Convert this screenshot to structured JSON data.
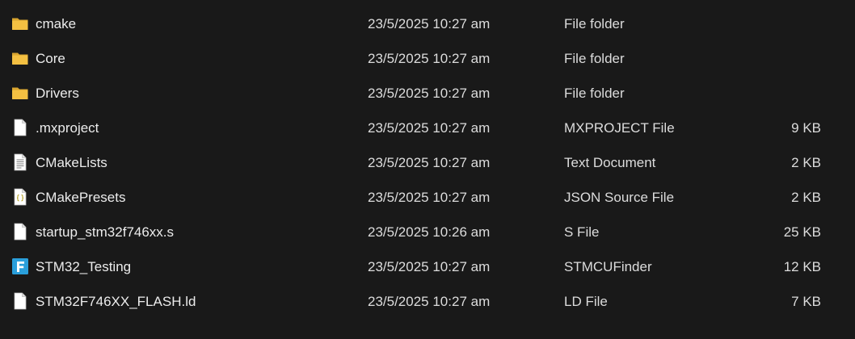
{
  "files": [
    {
      "name": "cmake",
      "date": "23/5/2025 10:27 am",
      "type": "File folder",
      "size": "",
      "icon": "folder-icon"
    },
    {
      "name": "Core",
      "date": "23/5/2025 10:27 am",
      "type": "File folder",
      "size": "",
      "icon": "folder-icon"
    },
    {
      "name": "Drivers",
      "date": "23/5/2025 10:27 am",
      "type": "File folder",
      "size": "",
      "icon": "folder-icon"
    },
    {
      "name": ".mxproject",
      "date": "23/5/2025 10:27 am",
      "type": "MXPROJECT File",
      "size": "9 KB",
      "icon": "blank-file-icon"
    },
    {
      "name": "CMakeLists",
      "date": "23/5/2025 10:27 am",
      "type": "Text Document",
      "size": "2 KB",
      "icon": "text-file-icon"
    },
    {
      "name": "CMakePresets",
      "date": "23/5/2025 10:27 am",
      "type": "JSON Source File",
      "size": "2 KB",
      "icon": "json-file-icon"
    },
    {
      "name": "startup_stm32f746xx.s",
      "date": "23/5/2025 10:26 am",
      "type": "S File",
      "size": "25 KB",
      "icon": "blank-file-icon"
    },
    {
      "name": "STM32_Testing",
      "date": "23/5/2025 10:27 am",
      "type": "STMCUFinder",
      "size": "12 KB",
      "icon": "stmcufinder-icon"
    },
    {
      "name": "STM32F746XX_FLASH.ld",
      "date": "23/5/2025 10:27 am",
      "type": "LD File",
      "size": "7 KB",
      "icon": "blank-file-icon"
    }
  ],
  "colors": {
    "background": "#191919",
    "text": "#dcdcdc",
    "folder": "#f4c042",
    "stmcufinder": "#2a9fdb"
  }
}
